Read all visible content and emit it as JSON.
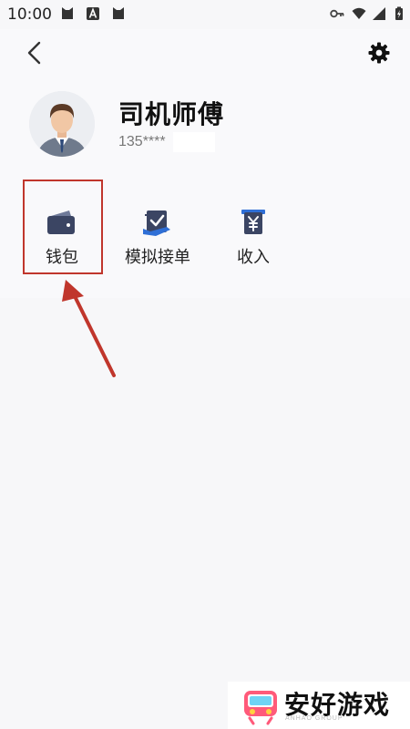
{
  "status_bar": {
    "time": "10:00",
    "left_icons": [
      "cat-app-icon",
      "a-app-icon",
      "cat-app-icon"
    ],
    "right_icons": [
      "key-icon",
      "wifi-icon",
      "signal-icon",
      "battery-charging-icon"
    ]
  },
  "header": {
    "back_icon": "chevron-left-icon",
    "settings_icon": "gear-icon"
  },
  "profile": {
    "name": "司机师傅",
    "phone": "135****"
  },
  "menu": {
    "items": [
      {
        "label": "钱包",
        "icon": "wallet-icon"
      },
      {
        "label": "模拟接单",
        "icon": "order-check-icon"
      },
      {
        "label": "收入",
        "icon": "income-yen-icon"
      }
    ]
  },
  "colors": {
    "highlight": "#c0362c",
    "icon_dark": "#3b4563",
    "icon_accent": "#2f6fd6"
  },
  "watermark": {
    "text": "安好游戏",
    "sub": "ANHAO GROUP"
  }
}
